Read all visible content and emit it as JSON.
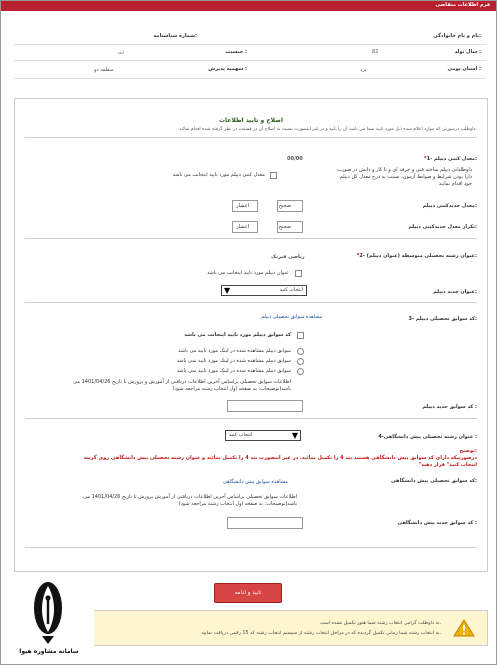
{
  "header": {
    "title": "فرم اطلاعات متقاضی"
  },
  "personal": {
    "name_label": "نام و نام خانوادگی:",
    "id_label": "شماره شناسنامه:",
    "birth_label": "سال تولد :",
    "birth_value": "82",
    "gender_label": "جنسیت :",
    "gender_value": "زن",
    "province_label": "استان بومی :",
    "province_value": "یزد",
    "quota_label": "سهمیه پذیرش :",
    "quota_value": "منطقه دو"
  },
  "section": {
    "title": "اصلاح و تایید اطلاعات",
    "note": "داوطلب درصورتی که موارد اعلام شده ذیل مورد تایید شما می باشد آن را تایید و در غیر اینصورت نسبت به اصلاح آن در قسمت در نظر گرفته شده اقدام نمائید."
  },
  "gpa": {
    "label": "1- معدل کتبی دیپلم:",
    "required": "*",
    "value": "00/00",
    "confirm_text": "معدل کتبی دیپلم مورد تایید اینجانب می باشد",
    "help1": "داوطلبانی دیپلم ساخته فنی و حرفه ای و یا کار و دانش در صورت",
    "help2": "دارا بودن شرایط و ضوابط آزمون، نسبت به درج معدل کل دیپلم",
    "help3": "خود اقدام نمایند",
    "new_label": "معدل جدیدکتبی دیپلم:",
    "repeat_label": "تکرار معدل جدیدکتبی دیپلم:",
    "integer": "صحیح",
    "decimal": "اعشار"
  },
  "field": {
    "label": "2- عنوان رشته تحصیلی متوسطه (عنوان دیپلم):",
    "required": "*",
    "value": "ریاضی فیزیک",
    "confirm_text": "عنوان دیپلم مورد تایید اینجانب می باشد",
    "new_label": "عنوان جدید دیپلم:",
    "select_value": "انتخاب کنید"
  },
  "code": {
    "label": "3- کد سوابق تحصیلی دیپلم:",
    "link": "مشاهده سوابق تحصیلی دیپلم",
    "confirm_text": "کد سوابق دیپلم مورد تایید اینجانب می باشد",
    "radio1": "سوابق دیپلم مشاهده شده در لینک مورد تایید می باشد",
    "radio2": "سوابق دیپلم مشاهده شده در لینک مورد تایید نمی باشد",
    "radio3": "سوابق دیپلم مشاهده شده در لینک مورد تایید نمی باشد",
    "info1": "اطلاعات سوابق تحصیلی براساس آخرین اطلاعات دریافتی از آموزش و پرورش تا تاریخ 1401/04/26 می",
    "info2": "باشد(توضیحات: به صفحه اول انتخاب رشته مراجعه شود)",
    "new_label": "کد سوابق جدید دیپلم :"
  },
  "pre_uni": {
    "label": "4-عنوان رشته تحصیلی پیش دانشگاهی :",
    "select_value": "انتخاب کنید",
    "note_title": "توضیح:",
    "note1": "درصورتیکه دارای کد سوابق پیش دانشگاهی هستید بند 4 را تکمیل نمائید. در غیر اینصورت بند 4 را تکمیل نمائید و عنوان رشته تحصیلی پیش دانشگاهی روی گزینه",
    "note2": "\"انتخاب کنید\" قرار دهید",
    "code_label": "کد سوابق تحصیلی پیش دانشگاهی:",
    "code_link": "مشاهده سوابق پیش دانشگاهی",
    "info1": "اطلاعات سوابق تحصیلی براساس آخرین اطلاعات دریافتی از آموزش پرورش تا تاریخ 1401/04/26 می",
    "info2": "باشد(توضیحات: به صفحه اول انتخاب رشته مراجعه شود)",
    "new_label": "کد سوابق جدید پیش دانشگاهی :"
  },
  "submit": {
    "label": "تایید و ادامه"
  },
  "warning": {
    "line1": "به داوطلب گرامی انتخاب رشته شما هنوز تکمیل نشده است.",
    "line2": "به انتخاب رشته شما زمانی تکمیل گردیده که در مراحل انتخاب رشته از سیستم انتخاب رشته کد 15 رقمی دریافت نمایید."
  },
  "logo": {
    "text": "سامانه مشاوره هیوا"
  }
}
